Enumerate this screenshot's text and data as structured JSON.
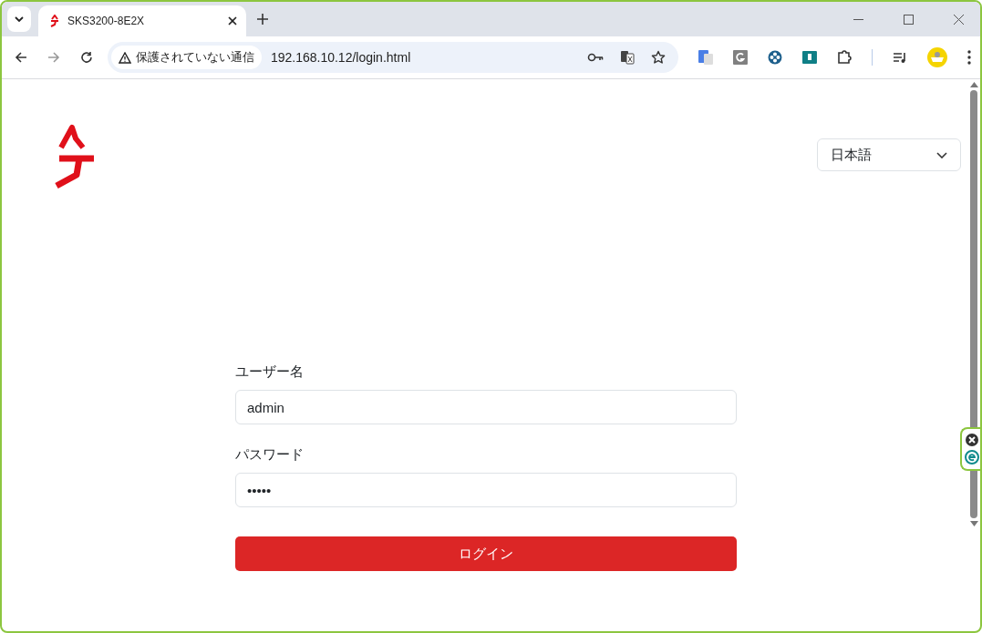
{
  "browser": {
    "tab": {
      "title": "SKS3200-8E2X",
      "selected": true
    },
    "address": {
      "security": "保護されていない通信",
      "url": "192.168.10.12/login.html"
    }
  },
  "page": {
    "language": {
      "value": "日本語"
    },
    "fields": [
      {
        "label": "ユーザー名",
        "value": "admin"
      },
      {
        "label": "パスワード",
        "value": "•••••"
      }
    ],
    "login_button": "ログイン"
  }
}
